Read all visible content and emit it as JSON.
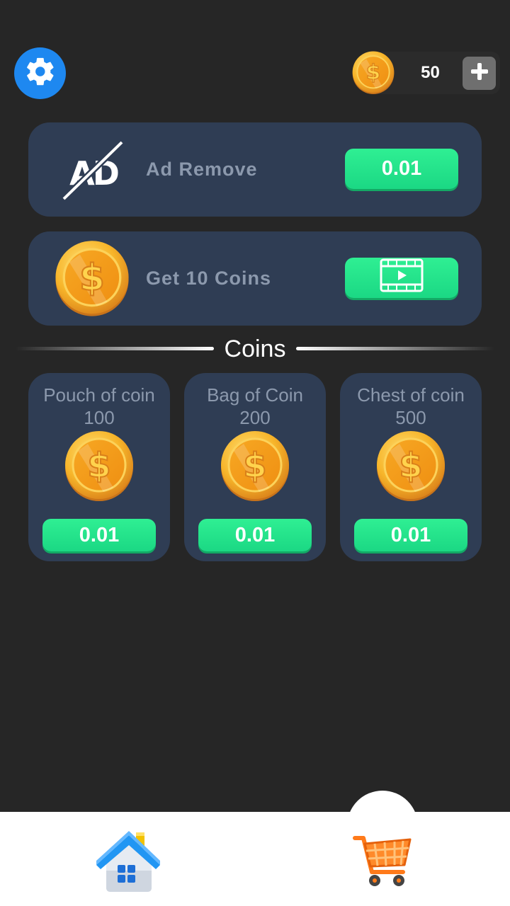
{
  "header": {
    "settings_icon": "gear-icon",
    "coin_count": "50",
    "add_coins_icon": "plus-icon"
  },
  "offers": [
    {
      "label": "Ad Remove",
      "icon_text": "AD",
      "icon": "no-ads-icon",
      "button_label": "0.01"
    },
    {
      "label": "Get 10 Coins",
      "icon": "coin-icon",
      "button_icon": "video-play-icon"
    }
  ],
  "section": {
    "title": "Coins"
  },
  "products": [
    {
      "name": "Pouch of coin",
      "amount": "100",
      "price": "0.01"
    },
    {
      "name": "Bag of Coin",
      "amount": "200",
      "price": "0.01"
    },
    {
      "name": "Chest of coin",
      "amount": "500",
      "price": "0.01"
    }
  ],
  "nav": {
    "items": [
      {
        "icon": "home-icon"
      },
      {
        "icon": "shopping-cart-icon",
        "active": true
      }
    ]
  },
  "colors": {
    "background": "#262626",
    "card": "#2f3d54",
    "accent_green": "#1fe08a",
    "settings_blue": "#1e88f0",
    "coin_gold": "#f4a61c"
  }
}
